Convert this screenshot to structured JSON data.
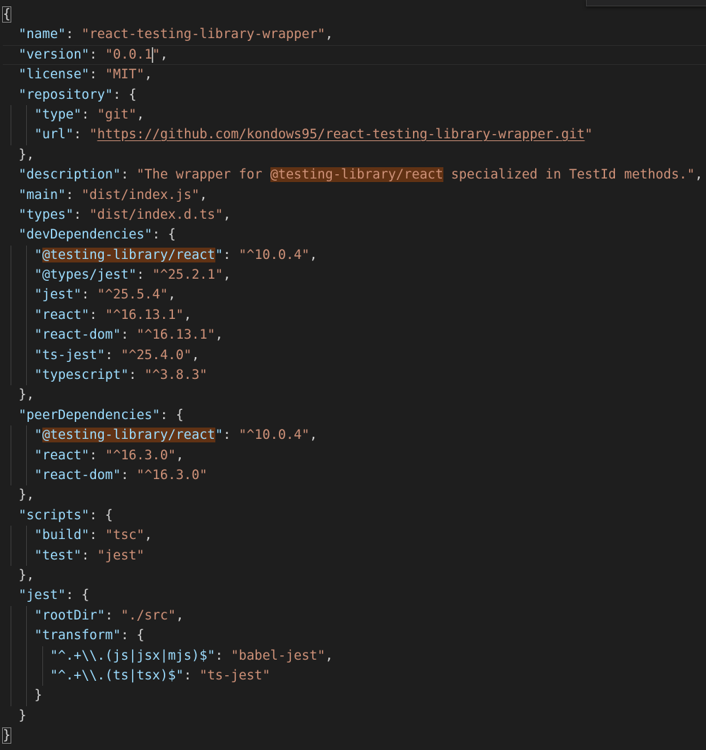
{
  "editor": {
    "lines": [
      {
        "indent": 0,
        "tokens": [
          {
            "t": "{",
            "c": "punct",
            "match": true
          }
        ]
      },
      {
        "indent": 1,
        "tokens": [
          {
            "t": "\"name\"",
            "c": "key"
          },
          {
            "t": ": ",
            "c": "punct"
          },
          {
            "t": "\"react-testing-library-wrapper\"",
            "c": "str"
          },
          {
            "t": ",",
            "c": "punct"
          }
        ]
      },
      {
        "indent": 1,
        "current": true,
        "tokens": [
          {
            "t": "\"version\"",
            "c": "key"
          },
          {
            "t": ": ",
            "c": "punct"
          },
          {
            "t": "\"0.0.1",
            "c": "str"
          },
          {
            "cursor": true
          },
          {
            "t": "\"",
            "c": "str"
          },
          {
            "t": ",",
            "c": "punct"
          }
        ]
      },
      {
        "indent": 1,
        "tokens": [
          {
            "t": "\"license\"",
            "c": "key"
          },
          {
            "t": ": ",
            "c": "punct"
          },
          {
            "t": "\"MIT\"",
            "c": "str"
          },
          {
            "t": ",",
            "c": "punct"
          }
        ]
      },
      {
        "indent": 1,
        "tokens": [
          {
            "t": "\"repository\"",
            "c": "key"
          },
          {
            "t": ": {",
            "c": "punct"
          }
        ]
      },
      {
        "indent": 2,
        "tokens": [
          {
            "t": "\"type\"",
            "c": "key"
          },
          {
            "t": ": ",
            "c": "punct"
          },
          {
            "t": "\"git\"",
            "c": "str"
          },
          {
            "t": ",",
            "c": "punct"
          }
        ]
      },
      {
        "indent": 2,
        "tokens": [
          {
            "t": "\"url\"",
            "c": "key"
          },
          {
            "t": ": ",
            "c": "punct"
          },
          {
            "t": "\"",
            "c": "str"
          },
          {
            "t": "https://github.com/kondows95/react-testing-library-wrapper.git",
            "c": "link"
          },
          {
            "t": "\"",
            "c": "str"
          }
        ]
      },
      {
        "indent": 1,
        "tokens": [
          {
            "t": "},",
            "c": "punct"
          }
        ]
      },
      {
        "indent": 1,
        "tokens": [
          {
            "t": "\"description\"",
            "c": "key"
          },
          {
            "t": ": ",
            "c": "punct"
          },
          {
            "t": "\"The wrapper for ",
            "c": "str"
          },
          {
            "t": "@testing-library/react",
            "c": "str",
            "hl": true
          },
          {
            "t": " specialized in TestId methods.\"",
            "c": "str"
          },
          {
            "t": ",",
            "c": "punct"
          }
        ]
      },
      {
        "indent": 1,
        "tokens": [
          {
            "t": "\"main\"",
            "c": "key"
          },
          {
            "t": ": ",
            "c": "punct"
          },
          {
            "t": "\"dist/index.js\"",
            "c": "str"
          },
          {
            "t": ",",
            "c": "punct"
          }
        ]
      },
      {
        "indent": 1,
        "tokens": [
          {
            "t": "\"types\"",
            "c": "key"
          },
          {
            "t": ": ",
            "c": "punct"
          },
          {
            "t": "\"dist/index.d.ts\"",
            "c": "str"
          },
          {
            "t": ",",
            "c": "punct"
          }
        ]
      },
      {
        "indent": 1,
        "tokens": [
          {
            "t": "\"devDependencies\"",
            "c": "key"
          },
          {
            "t": ": {",
            "c": "punct"
          }
        ]
      },
      {
        "indent": 2,
        "tokens": [
          {
            "t": "\"",
            "c": "key"
          },
          {
            "t": "@testing-library/react",
            "c": "key",
            "hl": true
          },
          {
            "t": "\"",
            "c": "key"
          },
          {
            "t": ": ",
            "c": "punct"
          },
          {
            "t": "\"^10.0.4\"",
            "c": "str"
          },
          {
            "t": ",",
            "c": "punct"
          }
        ]
      },
      {
        "indent": 2,
        "tokens": [
          {
            "t": "\"@types/jest\"",
            "c": "key"
          },
          {
            "t": ": ",
            "c": "punct"
          },
          {
            "t": "\"^25.2.1\"",
            "c": "str"
          },
          {
            "t": ",",
            "c": "punct"
          }
        ]
      },
      {
        "indent": 2,
        "tokens": [
          {
            "t": "\"jest\"",
            "c": "key"
          },
          {
            "t": ": ",
            "c": "punct"
          },
          {
            "t": "\"^25.5.4\"",
            "c": "str"
          },
          {
            "t": ",",
            "c": "punct"
          }
        ]
      },
      {
        "indent": 2,
        "tokens": [
          {
            "t": "\"react\"",
            "c": "key"
          },
          {
            "t": ": ",
            "c": "punct"
          },
          {
            "t": "\"^16.13.1\"",
            "c": "str"
          },
          {
            "t": ",",
            "c": "punct"
          }
        ]
      },
      {
        "indent": 2,
        "tokens": [
          {
            "t": "\"react-dom\"",
            "c": "key"
          },
          {
            "t": ": ",
            "c": "punct"
          },
          {
            "t": "\"^16.13.1\"",
            "c": "str"
          },
          {
            "t": ",",
            "c": "punct"
          }
        ]
      },
      {
        "indent": 2,
        "tokens": [
          {
            "t": "\"ts-jest\"",
            "c": "key"
          },
          {
            "t": ": ",
            "c": "punct"
          },
          {
            "t": "\"^25.4.0\"",
            "c": "str"
          },
          {
            "t": ",",
            "c": "punct"
          }
        ]
      },
      {
        "indent": 2,
        "tokens": [
          {
            "t": "\"typescript\"",
            "c": "key"
          },
          {
            "t": ": ",
            "c": "punct"
          },
          {
            "t": "\"^3.8.3\"",
            "c": "str"
          }
        ]
      },
      {
        "indent": 1,
        "tokens": [
          {
            "t": "},",
            "c": "punct"
          }
        ]
      },
      {
        "indent": 1,
        "tokens": [
          {
            "t": "\"peerDependencies\"",
            "c": "key"
          },
          {
            "t": ": {",
            "c": "punct"
          }
        ]
      },
      {
        "indent": 2,
        "tokens": [
          {
            "t": "\"",
            "c": "key"
          },
          {
            "t": "@testing-library/react",
            "c": "key",
            "hl": true
          },
          {
            "t": "\"",
            "c": "key"
          },
          {
            "t": ": ",
            "c": "punct"
          },
          {
            "t": "\"^10.0.4\"",
            "c": "str"
          },
          {
            "t": ",",
            "c": "punct"
          }
        ]
      },
      {
        "indent": 2,
        "tokens": [
          {
            "t": "\"react\"",
            "c": "key"
          },
          {
            "t": ": ",
            "c": "punct"
          },
          {
            "t": "\"^16.3.0\"",
            "c": "str"
          },
          {
            "t": ",",
            "c": "punct"
          }
        ]
      },
      {
        "indent": 2,
        "tokens": [
          {
            "t": "\"react-dom\"",
            "c": "key"
          },
          {
            "t": ": ",
            "c": "punct"
          },
          {
            "t": "\"^16.3.0\"",
            "c": "str"
          }
        ]
      },
      {
        "indent": 1,
        "tokens": [
          {
            "t": "},",
            "c": "punct"
          }
        ]
      },
      {
        "indent": 1,
        "tokens": [
          {
            "t": "\"scripts\"",
            "c": "key"
          },
          {
            "t": ": {",
            "c": "punct"
          }
        ]
      },
      {
        "indent": 2,
        "tokens": [
          {
            "t": "\"build\"",
            "c": "key"
          },
          {
            "t": ": ",
            "c": "punct"
          },
          {
            "t": "\"tsc\"",
            "c": "str"
          },
          {
            "t": ",",
            "c": "punct"
          }
        ]
      },
      {
        "indent": 2,
        "tokens": [
          {
            "t": "\"test\"",
            "c": "key"
          },
          {
            "t": ": ",
            "c": "punct"
          },
          {
            "t": "\"jest\"",
            "c": "str"
          }
        ]
      },
      {
        "indent": 1,
        "tokens": [
          {
            "t": "},",
            "c": "punct"
          }
        ]
      },
      {
        "indent": 1,
        "tokens": [
          {
            "t": "\"jest\"",
            "c": "key"
          },
          {
            "t": ": {",
            "c": "punct"
          }
        ]
      },
      {
        "indent": 2,
        "tokens": [
          {
            "t": "\"rootDir\"",
            "c": "key"
          },
          {
            "t": ": ",
            "c": "punct"
          },
          {
            "t": "\"./src\"",
            "c": "str"
          },
          {
            "t": ",",
            "c": "punct"
          }
        ]
      },
      {
        "indent": 2,
        "tokens": [
          {
            "t": "\"transform\"",
            "c": "key"
          },
          {
            "t": ": {",
            "c": "punct"
          }
        ]
      },
      {
        "indent": 3,
        "tokens": [
          {
            "t": "\"^.+\\\\.(js|jsx|mjs)$\"",
            "c": "key"
          },
          {
            "t": ": ",
            "c": "punct"
          },
          {
            "t": "\"babel-jest\"",
            "c": "str"
          },
          {
            "t": ",",
            "c": "punct"
          }
        ]
      },
      {
        "indent": 3,
        "tokens": [
          {
            "t": "\"^.+\\\\.(ts|tsx)$\"",
            "c": "key"
          },
          {
            "t": ": ",
            "c": "punct"
          },
          {
            "t": "\"ts-jest\"",
            "c": "str"
          }
        ]
      },
      {
        "indent": 2,
        "tokens": [
          {
            "t": "}",
            "c": "punct"
          }
        ]
      },
      {
        "indent": 1,
        "tokens": [
          {
            "t": "}",
            "c": "punct"
          }
        ]
      },
      {
        "indent": 0,
        "tokens": [
          {
            "t": "}",
            "c": "punct",
            "match": true
          }
        ]
      }
    ]
  },
  "colors": {
    "background": "#1e1e1e",
    "key": "#9cdcfe",
    "string": "#ce9178",
    "punctuation": "#d4d4d4",
    "find_highlight": "#613214"
  }
}
